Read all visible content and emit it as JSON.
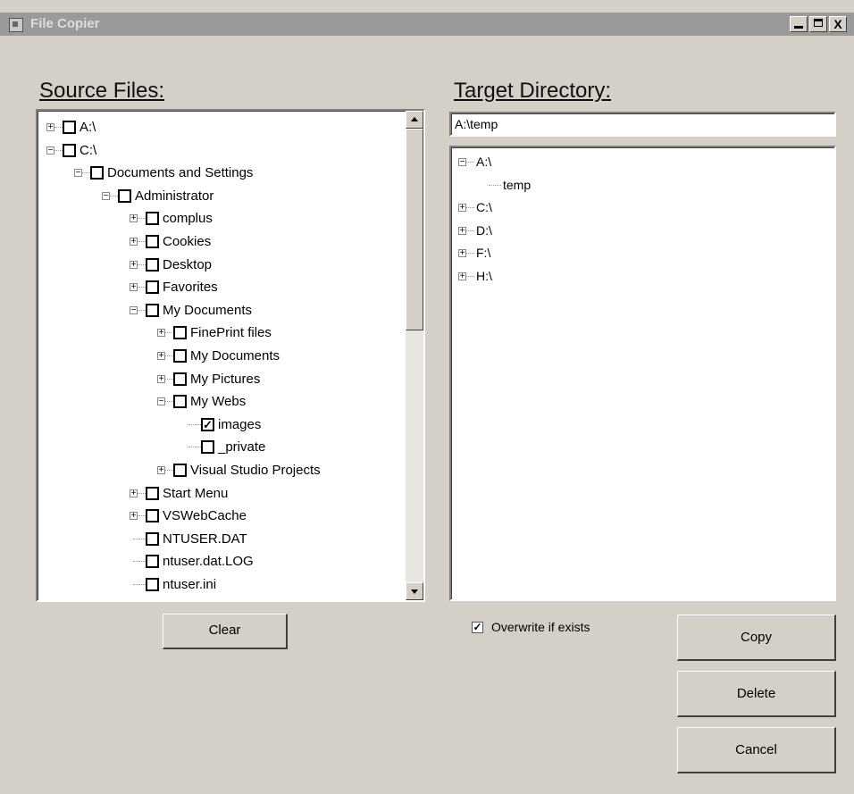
{
  "window": {
    "title": "File Copier",
    "controls": {
      "minimize": "_",
      "maximize": "□",
      "close": "X"
    }
  },
  "source": {
    "heading": "Source Files:",
    "tree": [
      {
        "label": "A:\\",
        "depth": 0,
        "expander": "+",
        "checked": false
      },
      {
        "label": "C:\\",
        "depth": 0,
        "expander": "−",
        "checked": false
      },
      {
        "label": "Documents and Settings",
        "depth": 1,
        "expander": "−",
        "checked": false
      },
      {
        "label": "Administrator",
        "depth": 2,
        "expander": "−",
        "checked": false
      },
      {
        "label": "complus",
        "depth": 3,
        "expander": "+",
        "checked": false
      },
      {
        "label": "Cookies",
        "depth": 3,
        "expander": "+",
        "checked": false
      },
      {
        "label": "Desktop",
        "depth": 3,
        "expander": "+",
        "checked": false
      },
      {
        "label": "Favorites",
        "depth": 3,
        "expander": "+",
        "checked": false
      },
      {
        "label": "My Documents",
        "depth": 3,
        "expander": "−",
        "checked": false
      },
      {
        "label": "FinePrint files",
        "depth": 4,
        "expander": "+",
        "checked": false
      },
      {
        "label": "My Documents",
        "depth": 4,
        "expander": "+",
        "checked": false
      },
      {
        "label": "My Pictures",
        "depth": 4,
        "expander": "+",
        "checked": false
      },
      {
        "label": "My Webs",
        "depth": 4,
        "expander": "−",
        "checked": false
      },
      {
        "label": "images",
        "depth": 5,
        "expander": "",
        "checked": true
      },
      {
        "label": "_private",
        "depth": 5,
        "expander": "",
        "checked": false
      },
      {
        "label": "Visual Studio Projects",
        "depth": 4,
        "expander": "+",
        "checked": false
      },
      {
        "label": "Start Menu",
        "depth": 3,
        "expander": "+",
        "checked": false
      },
      {
        "label": "VSWebCache",
        "depth": 3,
        "expander": "+",
        "checked": false
      },
      {
        "label": "NTUSER.DAT",
        "depth": 3,
        "expander": "",
        "checked": false
      },
      {
        "label": "ntuser.dat.LOG",
        "depth": 3,
        "expander": "",
        "checked": false
      },
      {
        "label": "ntuser.ini",
        "depth": 3,
        "expander": "",
        "checked": false
      }
    ]
  },
  "target": {
    "heading": "Target Directory:",
    "path_value": "A:\\temp",
    "tree": [
      {
        "label": "A:\\",
        "depth": 0,
        "expander": "−"
      },
      {
        "label": "temp",
        "depth": 1,
        "expander": ""
      },
      {
        "label": "C:\\",
        "depth": 0,
        "expander": "+"
      },
      {
        "label": "D:\\",
        "depth": 0,
        "expander": "+"
      },
      {
        "label": "F:\\",
        "depth": 0,
        "expander": "+"
      },
      {
        "label": "H:\\",
        "depth": 0,
        "expander": "+"
      }
    ]
  },
  "buttons": {
    "clear": "Clear",
    "copy": "Copy",
    "delete": "Delete",
    "cancel": "Cancel"
  },
  "options": {
    "overwrite_label": "Overwrite if exists",
    "overwrite_checked": true
  }
}
